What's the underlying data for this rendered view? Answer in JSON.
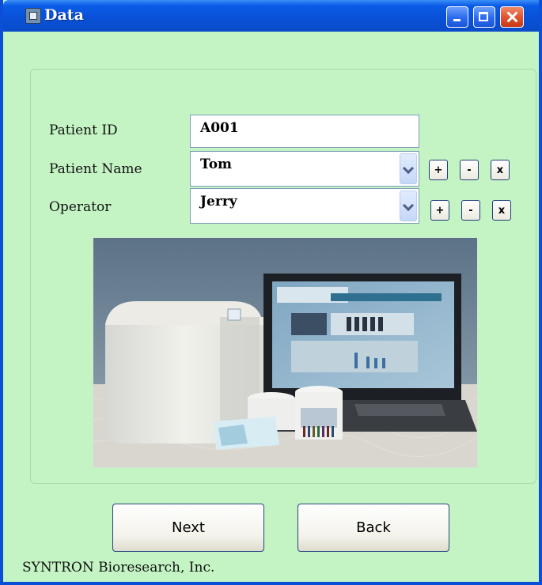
{
  "window": {
    "title": "Data",
    "icon": "app-window-icon"
  },
  "form": {
    "patient_id_label": "Patient ID",
    "patient_id_value": "A001",
    "patient_name_label": "Patient Name",
    "patient_name_value": "Tom",
    "operator_label": "Operator",
    "operator_value": "Jerry",
    "add_label": "+",
    "remove_label": "-",
    "clear_label": "x"
  },
  "photo": {
    "subject": "device-with-laptop-and-sample-cups"
  },
  "buttons": {
    "next_label": "Next",
    "back_label": "Back"
  },
  "footer": {
    "company": "SYNTRON Bioresearch, Inc."
  },
  "colors": {
    "titlebar": "#0850d6",
    "client_background": "#c4f4c4",
    "close_button": "#e0512c"
  }
}
